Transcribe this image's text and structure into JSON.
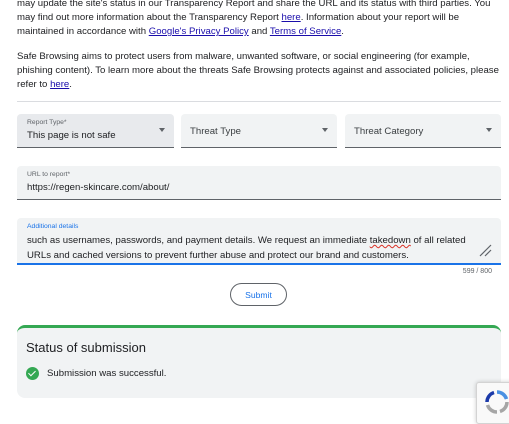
{
  "intro": {
    "line1": "may update the site's status in our Transparency Report and share the URL and its status with third parties. You",
    "line2_before": "may find out more information about the Transparency Report ",
    "line2_link": "here",
    "line2_after": ". Information about your report will be",
    "line3_before": "maintained in accordance with ",
    "privacy_link": "Google's Privacy Policy",
    "and_text": " and ",
    "terms_link": "Terms of Service",
    "line3_end": "."
  },
  "safe_browsing": {
    "text": "Safe Browsing aims to protect users from malware, unwanted software, or social engineering (for example, phishing content). To learn more about the threats Safe Browsing protects against and associated policies, please refer to ",
    "link": "here",
    "end": "."
  },
  "report_type": {
    "label": "Report Type*",
    "value": "This page is not safe",
    "icon": "caret-down-icon"
  },
  "threat_type": {
    "placeholder": "Threat Type",
    "icon": "caret-down-icon"
  },
  "threat_category": {
    "placeholder": "Threat Category",
    "icon": "caret-down-icon"
  },
  "url_field": {
    "label": "URL to report*",
    "value": "https://regen-skincare.com/about/"
  },
  "details_field": {
    "label": "Additional details",
    "text_before": "such as usernames, passwords, and payment details. We request an immediate ",
    "misspelled": "takedown",
    "text_after": " of all related URLs and cached versions to prevent further abuse and protect our brand and customers.",
    "counter": "599 / 800"
  },
  "submit_label": "Submit",
  "status": {
    "title": "Status of submission",
    "message": "Submission was successful.",
    "icon": "check-circle-icon"
  },
  "colors": {
    "accent": "#1a73e8",
    "success": "#34a853",
    "link": "#1a0dab"
  }
}
